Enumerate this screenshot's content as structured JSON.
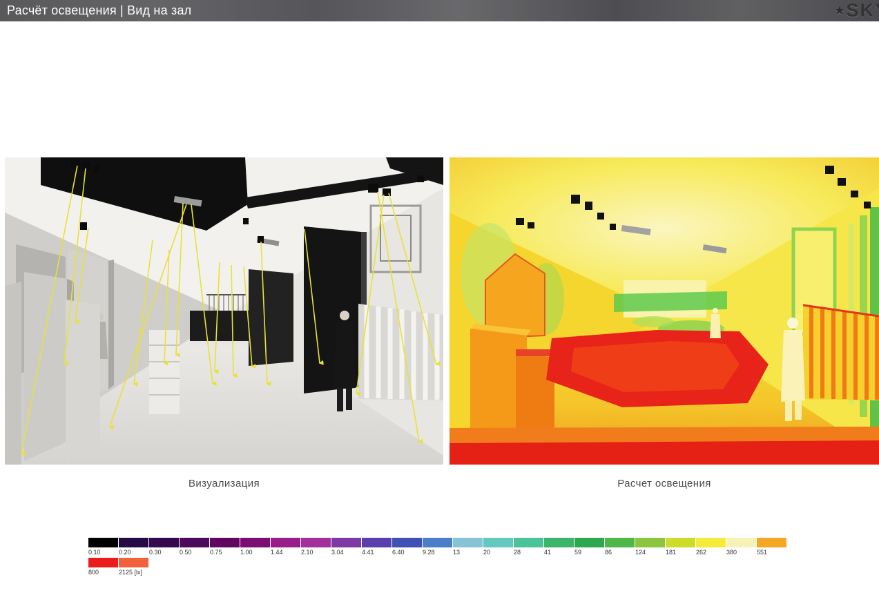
{
  "header": {
    "title": "Расчёт освещения | Вид на зал",
    "logo_star": "★",
    "logo_text": "SKY"
  },
  "figures": {
    "visualization": {
      "caption": "Визуализация"
    },
    "calculation": {
      "caption": "Расчет освещения"
    }
  },
  "legend": {
    "unit": "[lx]",
    "row1": [
      {
        "value": "0.10",
        "color": "#000000"
      },
      {
        "value": "0.20",
        "color": "#250b46"
      },
      {
        "value": "0.30",
        "color": "#35094f"
      },
      {
        "value": "0.50",
        "color": "#4b0a5c"
      },
      {
        "value": "0.75",
        "color": "#61075f"
      },
      {
        "value": "1.00",
        "color": "#7c0d72"
      },
      {
        "value": "1.44",
        "color": "#981c8a"
      },
      {
        "value": "2.10",
        "color": "#a42f9c"
      },
      {
        "value": "3.04",
        "color": "#7e3aa4"
      },
      {
        "value": "4.41",
        "color": "#5a3fae"
      },
      {
        "value": "6.40",
        "color": "#3f51b5"
      },
      {
        "value": "9.28",
        "color": "#4a7ec8"
      },
      {
        "value": "13",
        "color": "#86c3d7"
      },
      {
        "value": "20",
        "color": "#63c8bd"
      },
      {
        "value": "28",
        "color": "#4cc29b"
      },
      {
        "value": "41",
        "color": "#3cb56a"
      },
      {
        "value": "59",
        "color": "#2ea84e"
      },
      {
        "value": "86",
        "color": "#4fb648"
      },
      {
        "value": "124",
        "color": "#8cc63f"
      },
      {
        "value": "181",
        "color": "#cddc29"
      },
      {
        "value": "262",
        "color": "#f3ed3a"
      },
      {
        "value": "380",
        "color": "#f7f3b8"
      },
      {
        "value": "551",
        "color": "#f5a623"
      }
    ],
    "row2": [
      {
        "value": "800",
        "color": "#ec1c1c"
      },
      {
        "value": "2125 [lx]",
        "color": "#f2623d"
      }
    ]
  }
}
